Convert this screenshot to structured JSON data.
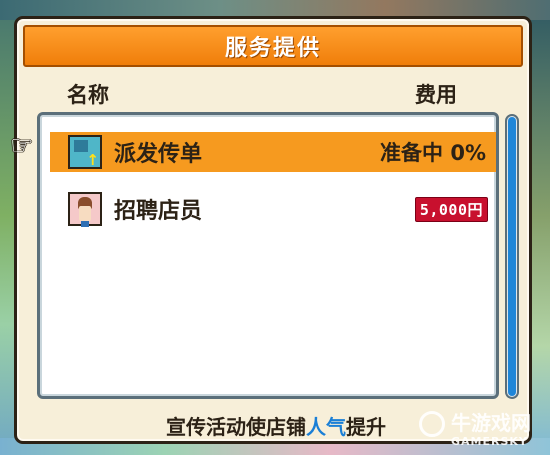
{
  "dialog": {
    "title": "服务提供",
    "columns": {
      "name": "名称",
      "cost": "费用"
    },
    "items": [
      {
        "label": "派发传单",
        "status": "准备中 0%",
        "icon": "flyer-icon",
        "selected": true
      },
      {
        "label": "招聘店员",
        "price": "5,000円",
        "icon": "staff-icon",
        "selected": false
      }
    ],
    "footer": {
      "prefix": "宣传活动使店铺",
      "highlight": "人气",
      "suffix": "提升"
    }
  },
  "watermark": {
    "site": "牛游戏网",
    "brand": "GAMERSKY"
  },
  "colors": {
    "title_bar": "#f07e0a",
    "selected_row": "#f69a1f",
    "price_badge": "#c8102e",
    "highlight_text": "#1a7fd6",
    "scroll_thumb": "#1f86d8"
  }
}
